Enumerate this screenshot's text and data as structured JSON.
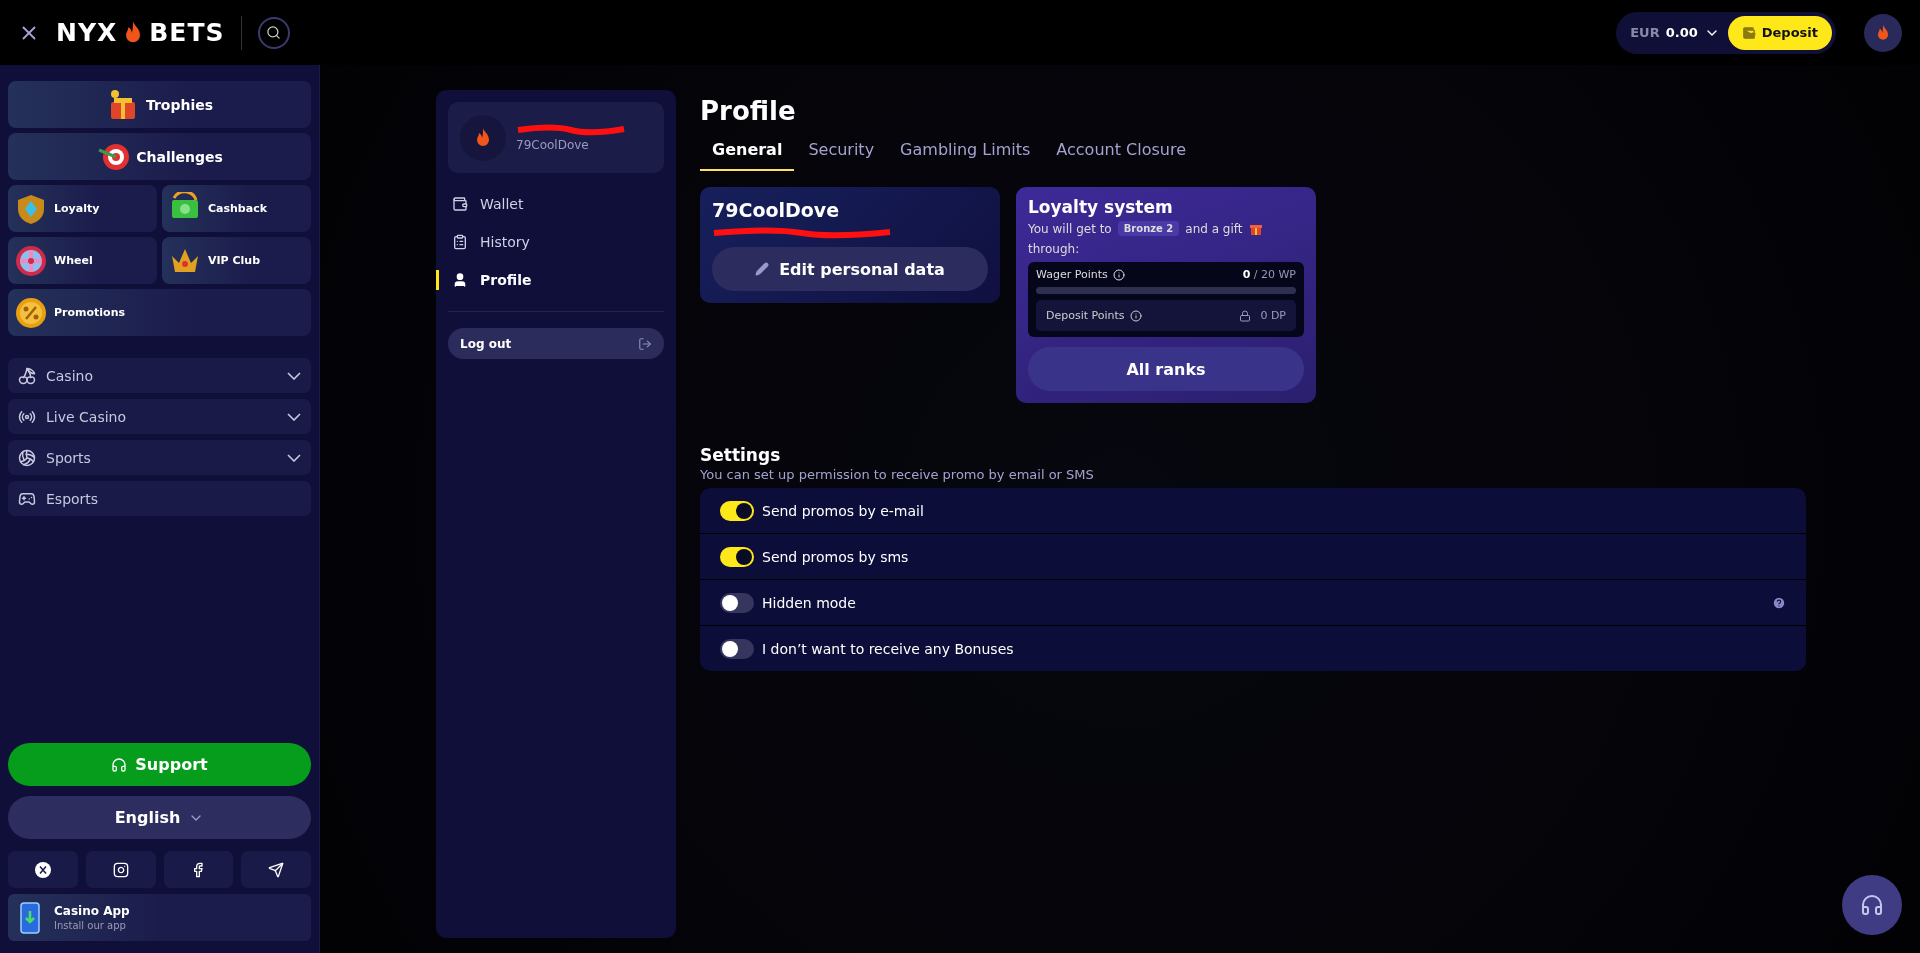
{
  "header": {
    "logo_left": "NYX",
    "logo_right": "BETS",
    "currency": "EUR",
    "balance": "0.00",
    "deposit": "Deposit"
  },
  "sidebar": {
    "promo_tiles": [
      {
        "label": "Trophies",
        "kind": "wide"
      },
      {
        "label": "Challenges",
        "kind": "wide"
      },
      {
        "label": "Loyalty",
        "kind": "half"
      },
      {
        "label": "Cashback",
        "kind": "half"
      },
      {
        "label": "Wheel",
        "kind": "half"
      },
      {
        "label": "VIP Club",
        "kind": "half"
      },
      {
        "label": "Promotions",
        "kind": "full"
      }
    ],
    "menu": [
      {
        "label": "Casino",
        "has_submenu": true
      },
      {
        "label": "Live Casino",
        "has_submenu": true
      },
      {
        "label": "Sports",
        "has_submenu": true
      },
      {
        "label": "Esports",
        "has_submenu": false
      }
    ],
    "support": "Support",
    "language": "English",
    "app": {
      "title": "Casino App",
      "subtitle": "Install our app"
    }
  },
  "account_nav": {
    "username": "79CoolDove",
    "items": [
      {
        "label": "Wallet",
        "selected": false
      },
      {
        "label": "History",
        "selected": false
      },
      {
        "label": "Profile",
        "selected": true
      }
    ],
    "logout": "Log out"
  },
  "profile": {
    "title": "Profile",
    "tabs": [
      {
        "label": "General",
        "selected": true
      },
      {
        "label": "Security",
        "selected": false
      },
      {
        "label": "Gambling Limits",
        "selected": false
      },
      {
        "label": "Account Closure",
        "selected": false
      }
    ],
    "user_card": {
      "username": "79CoolDove",
      "edit": "Edit personal data"
    },
    "loyalty": {
      "title": "Loyalty system",
      "text_before": "You will get to",
      "rank": "Bronze 2",
      "text_after": "and a gift",
      "text_end": "through:",
      "wager": {
        "label": "Wager Points",
        "reading": "**0** / 20 WP",
        "level": 0
      },
      "deposit": {
        "label": "Deposit Points",
        "reading": "0 DP",
        "locked": true
      },
      "button": "All ranks"
    },
    "settings": {
      "title": "Settings",
      "subtitle": "You can set up permission to receive promo by email or SMS",
      "rows": [
        {
          "label": "Send promos by e-mail",
          "on": true,
          "help": false
        },
        {
          "label": "Send promos by sms",
          "on": true,
          "help": false
        },
        {
          "label": "Hidden mode",
          "on": false,
          "help": true
        },
        {
          "label": "I don’t want to receive any Bonuses",
          "on": false,
          "help": false
        }
      ]
    }
  }
}
